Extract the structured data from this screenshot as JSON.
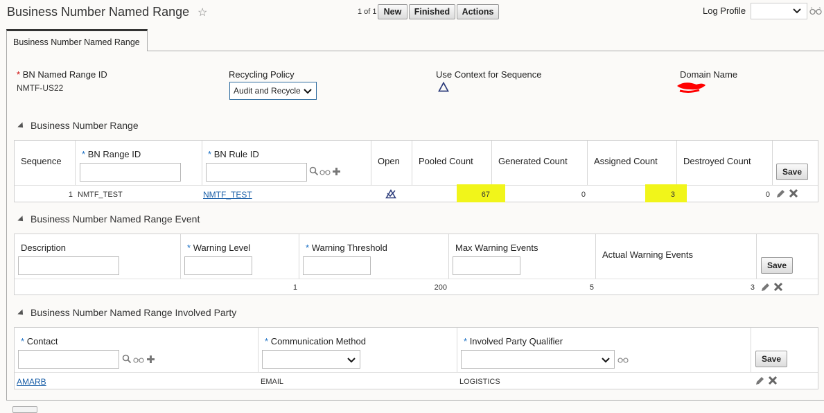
{
  "header": {
    "title": "Business Number Named Range",
    "pager": "1 of 1",
    "buttons": {
      "new": "New",
      "finished": "Finished",
      "actions": "Actions"
    },
    "log_profile_label": "Log Profile"
  },
  "tab": {
    "label": "Business Number Named Range"
  },
  "form": {
    "bn_named_range_id_label": "BN Named Range ID",
    "bn_named_range_id_value": "NMTF-US22",
    "recycling_policy_label": "Recycling Policy",
    "recycling_policy_value": "Audit and Recycle",
    "use_context_label": "Use Context for Sequence",
    "domain_name_label": "Domain Name",
    "required_mark": "*"
  },
  "range_section": {
    "title": "Business Number Range",
    "headers": {
      "sequence": "Sequence",
      "bn_range_id": "BN Range ID",
      "bn_rule_id": "BN Rule ID",
      "open": "Open",
      "pooled": "Pooled Count",
      "generated": "Generated Count",
      "assigned": "Assigned Count",
      "destroyed": "Destroyed Count"
    },
    "save": "Save",
    "row": {
      "sequence": "1",
      "bn_range_id": "NMTF_TEST",
      "bn_rule_id": "NMTF_TEST",
      "pooled": "67",
      "generated": "0",
      "assigned": "3",
      "destroyed": "0"
    }
  },
  "event_section": {
    "title": "Business Number Named Range Event",
    "headers": {
      "description": "Description",
      "warning_level": "Warning Level",
      "warning_threshold": "Warning Threshold",
      "max_warning_events": "Max Warning Events",
      "actual_warning_events": "Actual Warning Events"
    },
    "save": "Save",
    "row": {
      "description": "",
      "warning_level": "1",
      "warning_threshold": "200",
      "max_warning_events": "5",
      "actual_warning_events": "3"
    }
  },
  "party_section": {
    "title": "Business Number Named Range Involved Party",
    "headers": {
      "contact": "Contact",
      "communication_method": "Communication Method",
      "involved_party_qualifier": "Involved Party Qualifier"
    },
    "save": "Save",
    "row": {
      "contact": "AMARB",
      "communication_method": "EMAIL",
      "involved_party_qualifier": "LOGISTICS"
    }
  },
  "icons": {
    "star": "favorite-star-icon",
    "search": "search-icon",
    "glasses": "view-icon",
    "add": "add-icon",
    "edit": "pencil-icon",
    "delete": "close-icon",
    "dropdown": "chevron-down-icon"
  },
  "colors": {
    "highlight": "#f1f51a",
    "link": "#1a5fa8",
    "redaction": "#ff0000"
  }
}
